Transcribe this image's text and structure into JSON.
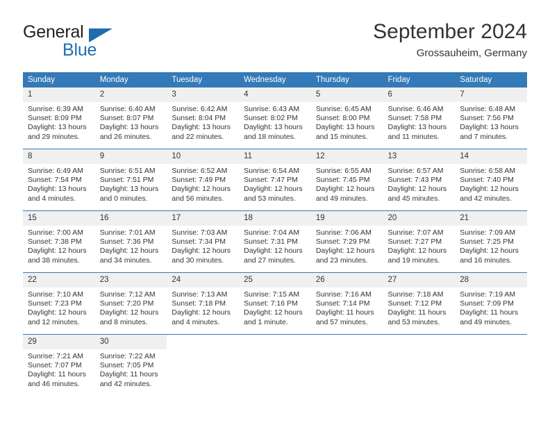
{
  "brand": {
    "name_part1": "General",
    "name_part2": "Blue",
    "accent_color": "#1f6cb0"
  },
  "header": {
    "title": "September 2024",
    "subtitle": "Grossauheim, Germany"
  },
  "theme": {
    "header_bg": "#3479b8",
    "daynum_bg": "#f0f0f0",
    "text": "#333333"
  },
  "weekdays": [
    "Sunday",
    "Monday",
    "Tuesday",
    "Wednesday",
    "Thursday",
    "Friday",
    "Saturday"
  ],
  "weeks": [
    [
      {
        "day": "1",
        "sunrise": "Sunrise: 6:39 AM",
        "sunset": "Sunset: 8:09 PM",
        "daylight_1": "Daylight: 13 hours",
        "daylight_2": "and 29 minutes."
      },
      {
        "day": "2",
        "sunrise": "Sunrise: 6:40 AM",
        "sunset": "Sunset: 8:07 PM",
        "daylight_1": "Daylight: 13 hours",
        "daylight_2": "and 26 minutes."
      },
      {
        "day": "3",
        "sunrise": "Sunrise: 6:42 AM",
        "sunset": "Sunset: 8:04 PM",
        "daylight_1": "Daylight: 13 hours",
        "daylight_2": "and 22 minutes."
      },
      {
        "day": "4",
        "sunrise": "Sunrise: 6:43 AM",
        "sunset": "Sunset: 8:02 PM",
        "daylight_1": "Daylight: 13 hours",
        "daylight_2": "and 18 minutes."
      },
      {
        "day": "5",
        "sunrise": "Sunrise: 6:45 AM",
        "sunset": "Sunset: 8:00 PM",
        "daylight_1": "Daylight: 13 hours",
        "daylight_2": "and 15 minutes."
      },
      {
        "day": "6",
        "sunrise": "Sunrise: 6:46 AM",
        "sunset": "Sunset: 7:58 PM",
        "daylight_1": "Daylight: 13 hours",
        "daylight_2": "and 11 minutes."
      },
      {
        "day": "7",
        "sunrise": "Sunrise: 6:48 AM",
        "sunset": "Sunset: 7:56 PM",
        "daylight_1": "Daylight: 13 hours",
        "daylight_2": "and 7 minutes."
      }
    ],
    [
      {
        "day": "8",
        "sunrise": "Sunrise: 6:49 AM",
        "sunset": "Sunset: 7:54 PM",
        "daylight_1": "Daylight: 13 hours",
        "daylight_2": "and 4 minutes."
      },
      {
        "day": "9",
        "sunrise": "Sunrise: 6:51 AM",
        "sunset": "Sunset: 7:51 PM",
        "daylight_1": "Daylight: 13 hours",
        "daylight_2": "and 0 minutes."
      },
      {
        "day": "10",
        "sunrise": "Sunrise: 6:52 AM",
        "sunset": "Sunset: 7:49 PM",
        "daylight_1": "Daylight: 12 hours",
        "daylight_2": "and 56 minutes."
      },
      {
        "day": "11",
        "sunrise": "Sunrise: 6:54 AM",
        "sunset": "Sunset: 7:47 PM",
        "daylight_1": "Daylight: 12 hours",
        "daylight_2": "and 53 minutes."
      },
      {
        "day": "12",
        "sunrise": "Sunrise: 6:55 AM",
        "sunset": "Sunset: 7:45 PM",
        "daylight_1": "Daylight: 12 hours",
        "daylight_2": "and 49 minutes."
      },
      {
        "day": "13",
        "sunrise": "Sunrise: 6:57 AM",
        "sunset": "Sunset: 7:43 PM",
        "daylight_1": "Daylight: 12 hours",
        "daylight_2": "and 45 minutes."
      },
      {
        "day": "14",
        "sunrise": "Sunrise: 6:58 AM",
        "sunset": "Sunset: 7:40 PM",
        "daylight_1": "Daylight: 12 hours",
        "daylight_2": "and 42 minutes."
      }
    ],
    [
      {
        "day": "15",
        "sunrise": "Sunrise: 7:00 AM",
        "sunset": "Sunset: 7:38 PM",
        "daylight_1": "Daylight: 12 hours",
        "daylight_2": "and 38 minutes."
      },
      {
        "day": "16",
        "sunrise": "Sunrise: 7:01 AM",
        "sunset": "Sunset: 7:36 PM",
        "daylight_1": "Daylight: 12 hours",
        "daylight_2": "and 34 minutes."
      },
      {
        "day": "17",
        "sunrise": "Sunrise: 7:03 AM",
        "sunset": "Sunset: 7:34 PM",
        "daylight_1": "Daylight: 12 hours",
        "daylight_2": "and 30 minutes."
      },
      {
        "day": "18",
        "sunrise": "Sunrise: 7:04 AM",
        "sunset": "Sunset: 7:31 PM",
        "daylight_1": "Daylight: 12 hours",
        "daylight_2": "and 27 minutes."
      },
      {
        "day": "19",
        "sunrise": "Sunrise: 7:06 AM",
        "sunset": "Sunset: 7:29 PM",
        "daylight_1": "Daylight: 12 hours",
        "daylight_2": "and 23 minutes."
      },
      {
        "day": "20",
        "sunrise": "Sunrise: 7:07 AM",
        "sunset": "Sunset: 7:27 PM",
        "daylight_1": "Daylight: 12 hours",
        "daylight_2": "and 19 minutes."
      },
      {
        "day": "21",
        "sunrise": "Sunrise: 7:09 AM",
        "sunset": "Sunset: 7:25 PM",
        "daylight_1": "Daylight: 12 hours",
        "daylight_2": "and 16 minutes."
      }
    ],
    [
      {
        "day": "22",
        "sunrise": "Sunrise: 7:10 AM",
        "sunset": "Sunset: 7:23 PM",
        "daylight_1": "Daylight: 12 hours",
        "daylight_2": "and 12 minutes."
      },
      {
        "day": "23",
        "sunrise": "Sunrise: 7:12 AM",
        "sunset": "Sunset: 7:20 PM",
        "daylight_1": "Daylight: 12 hours",
        "daylight_2": "and 8 minutes."
      },
      {
        "day": "24",
        "sunrise": "Sunrise: 7:13 AM",
        "sunset": "Sunset: 7:18 PM",
        "daylight_1": "Daylight: 12 hours",
        "daylight_2": "and 4 minutes."
      },
      {
        "day": "25",
        "sunrise": "Sunrise: 7:15 AM",
        "sunset": "Sunset: 7:16 PM",
        "daylight_1": "Daylight: 12 hours",
        "daylight_2": "and 1 minute."
      },
      {
        "day": "26",
        "sunrise": "Sunrise: 7:16 AM",
        "sunset": "Sunset: 7:14 PM",
        "daylight_1": "Daylight: 11 hours",
        "daylight_2": "and 57 minutes."
      },
      {
        "day": "27",
        "sunrise": "Sunrise: 7:18 AM",
        "sunset": "Sunset: 7:12 PM",
        "daylight_1": "Daylight: 11 hours",
        "daylight_2": "and 53 minutes."
      },
      {
        "day": "28",
        "sunrise": "Sunrise: 7:19 AM",
        "sunset": "Sunset: 7:09 PM",
        "daylight_1": "Daylight: 11 hours",
        "daylight_2": "and 49 minutes."
      }
    ],
    [
      {
        "day": "29",
        "sunrise": "Sunrise: 7:21 AM",
        "sunset": "Sunset: 7:07 PM",
        "daylight_1": "Daylight: 11 hours",
        "daylight_2": "and 46 minutes."
      },
      {
        "day": "30",
        "sunrise": "Sunrise: 7:22 AM",
        "sunset": "Sunset: 7:05 PM",
        "daylight_1": "Daylight: 11 hours",
        "daylight_2": "and 42 minutes."
      },
      {
        "day": "",
        "sunrise": "",
        "sunset": "",
        "daylight_1": "",
        "daylight_2": ""
      },
      {
        "day": "",
        "sunrise": "",
        "sunset": "",
        "daylight_1": "",
        "daylight_2": ""
      },
      {
        "day": "",
        "sunrise": "",
        "sunset": "",
        "daylight_1": "",
        "daylight_2": ""
      },
      {
        "day": "",
        "sunrise": "",
        "sunset": "",
        "daylight_1": "",
        "daylight_2": ""
      },
      {
        "day": "",
        "sunrise": "",
        "sunset": "",
        "daylight_1": "",
        "daylight_2": ""
      }
    ]
  ]
}
